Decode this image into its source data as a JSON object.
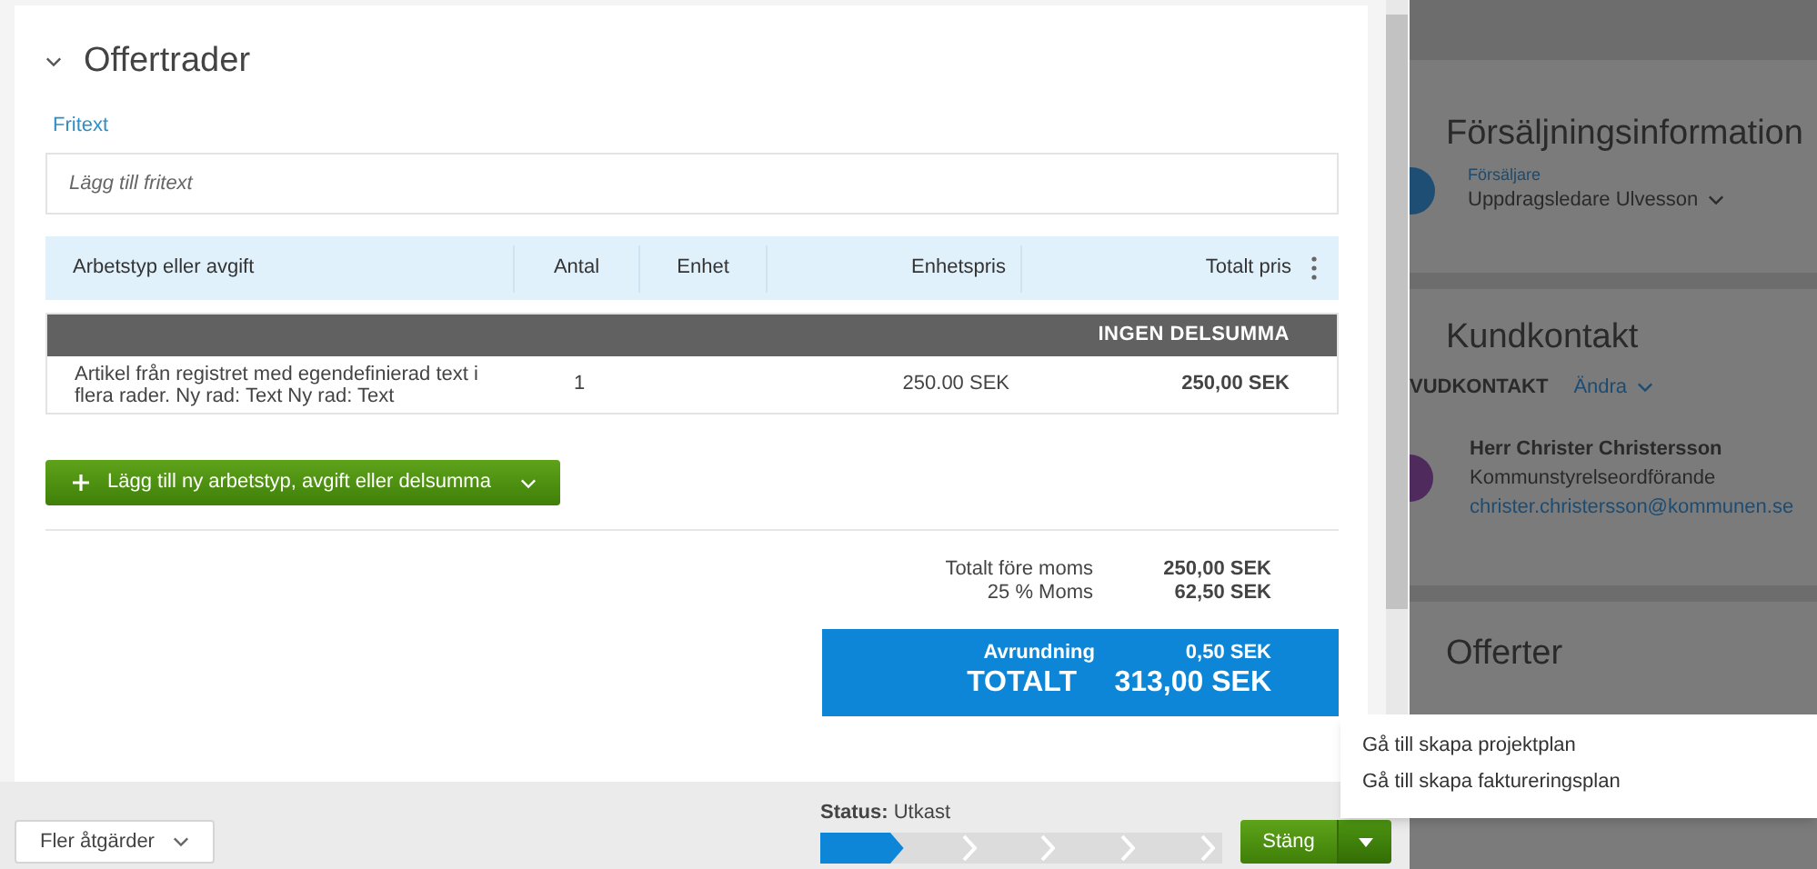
{
  "section": {
    "title": "Offertrader",
    "expanded": true,
    "fritext_label": "Fritext",
    "fritext_placeholder": "Lägg till fritext"
  },
  "table": {
    "columns": [
      "Arbetstyp eller avgift",
      "Antal",
      "Enhet",
      "Enhetspris",
      "Totalt pris"
    ],
    "group_header": "INGEN DELSUMMA",
    "rows": [
      {
        "description": "Artikel från registret med egendefinierad text i flera rader. Ny rad: Text Ny rad: Text",
        "antal": "1",
        "enhet": "",
        "enhetspris": "250.00 SEK",
        "totalt": "250,00 SEK"
      }
    ]
  },
  "add_button": "Lägg till ny arbetstyp, avgift eller delsumma",
  "totals": [
    {
      "label": "Totalt före moms",
      "value": "250,00 SEK"
    },
    {
      "label": "25 % Moms",
      "value": "62,50 SEK"
    }
  ],
  "summary": {
    "rounding_label": "Avrundning",
    "rounding_value": "0,50 SEK",
    "total_label": "TOTALT",
    "total_value": "313,00 SEK"
  },
  "footer": {
    "more_actions": "Fler åtgärder",
    "status_label": "Status:",
    "status_value": "Utkast",
    "steps": [
      {
        "selected": true
      },
      {
        "selected": false
      },
      {
        "selected": false
      },
      {
        "selected": false
      },
      {
        "selected": false
      }
    ],
    "close_button": "Stäng"
  },
  "menu": [
    "Gå till skapa projektplan",
    "Gå till skapa faktureringsplan"
  ],
  "sidebar": {
    "sales": {
      "title": "Försäljningsinformation",
      "label": "Försäljare",
      "value": "Uppdragsledare Ulvesson"
    },
    "contact": {
      "title": "Kundkontakt",
      "label": "VUDKONTAKT",
      "change": "Ändra",
      "name": "Herr Christer Christersson",
      "role": "Kommunstyrelseordförande",
      "email": "christer.christersson@kommunen.se"
    },
    "offers": {
      "title": "Offerter"
    }
  }
}
